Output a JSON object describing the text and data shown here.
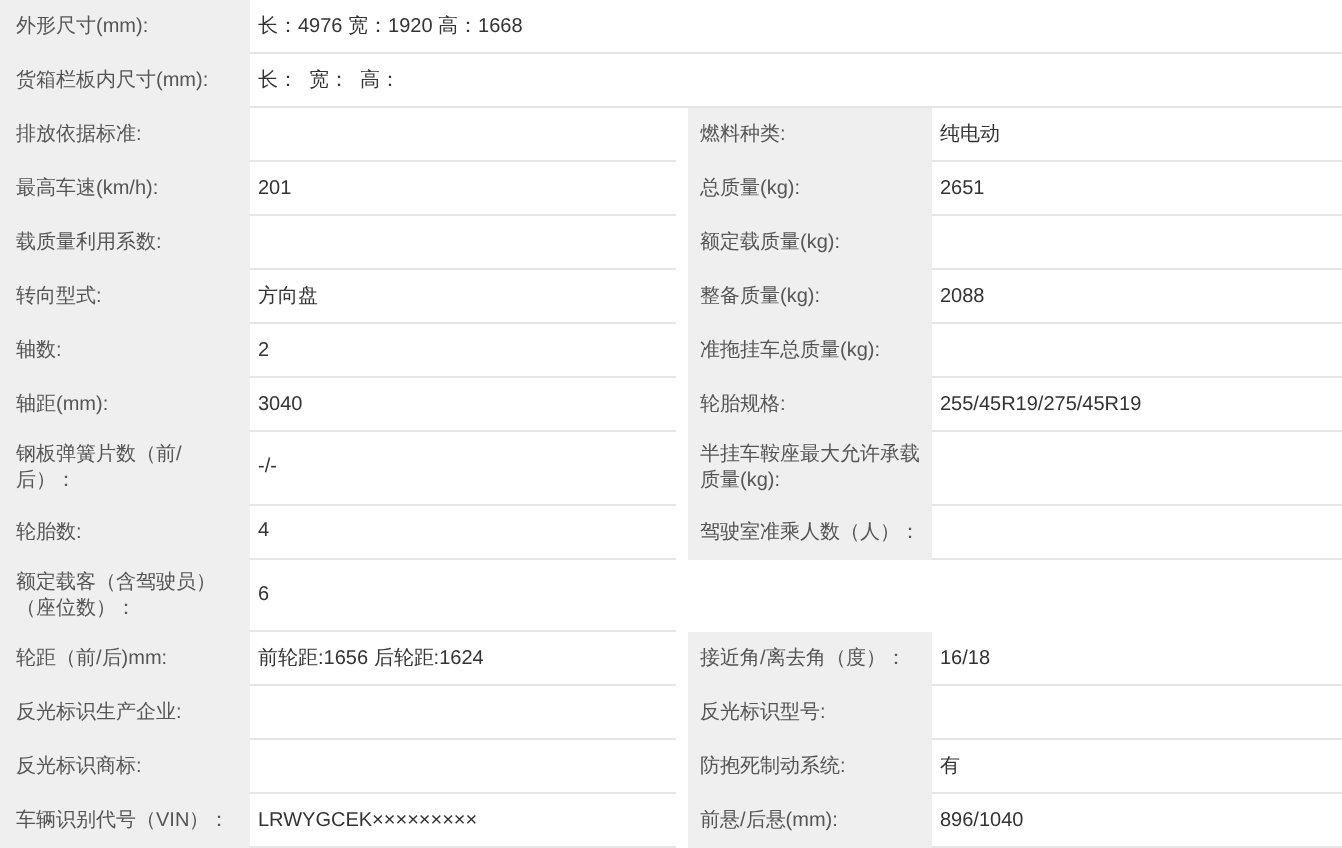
{
  "rows": [
    {
      "kind": "wide",
      "cells": [
        {
          "label": "外形尺寸(mm):",
          "value": "长：4976 宽：1920 高：1668"
        }
      ]
    },
    {
      "kind": "wide",
      "cells": [
        {
          "label": "货箱栏板内尺寸(mm):",
          "value": "长：  宽：  高："
        }
      ]
    },
    {
      "kind": "pair",
      "cells": [
        {
          "label": "排放依据标准:"
        },
        {
          "label": "燃料种类:",
          "value": "纯电动"
        }
      ]
    },
    {
      "kind": "pair",
      "cells": [
        {
          "label": "最高车速(km/h):",
          "value": "201"
        },
        {
          "label": "总质量(kg):",
          "value": "2651"
        }
      ]
    },
    {
      "kind": "pair",
      "cells": [
        {
          "label": "载质量利用系数:"
        },
        {
          "label": "额定载质量(kg):"
        }
      ]
    },
    {
      "kind": "pair",
      "cells": [
        {
          "label": "转向型式:",
          "value": "方向盘"
        },
        {
          "label": "整备质量(kg):",
          "value": "2088"
        }
      ]
    },
    {
      "kind": "pair",
      "cells": [
        {
          "label": "轴数:",
          "value": "2"
        },
        {
          "label": "准拖挂车总质量(kg):"
        }
      ]
    },
    {
      "kind": "pair",
      "cells": [
        {
          "label": "轴距(mm):",
          "value": "3040"
        },
        {
          "label": "轮胎规格:",
          "value": "255/45R19/275/45R19"
        }
      ]
    },
    {
      "kind": "pair",
      "cells": [
        {
          "label": "钢板弹簧片数（前/后）：",
          "value": "-/-"
        },
        {
          "label": "半挂车鞍座最大允许承载质量(kg):"
        }
      ]
    },
    {
      "kind": "pair",
      "cells": [
        {
          "label": "轮胎数:",
          "value": "4"
        },
        {
          "label": "驾驶室准乘人数（人）："
        }
      ]
    },
    {
      "kind": "half",
      "cells": [
        {
          "label": "额定载客（含驾驶员）（座位数）：",
          "value": "6"
        }
      ]
    },
    {
      "kind": "pair",
      "cells": [
        {
          "label": "轮距（前/后)mm:",
          "value": "前轮距:1656 后轮距:1624"
        },
        {
          "label": "接近角/离去角（度）：",
          "value": "16/18"
        }
      ]
    },
    {
      "kind": "pair",
      "cells": [
        {
          "label": "反光标识生产企业:"
        },
        {
          "label": "反光标识型号:"
        }
      ]
    },
    {
      "kind": "pair",
      "cells": [
        {
          "label": "反光标识商标:"
        },
        {
          "label": "防抱死制动系统:",
          "value": "有"
        }
      ]
    },
    {
      "kind": "pair",
      "cells": [
        {
          "label": "车辆识别代号（VIN）：",
          "value": "LRWYGCEK×××××××××"
        },
        {
          "label": "前悬/后悬(mm):",
          "value": "896/1040"
        }
      ]
    }
  ]
}
